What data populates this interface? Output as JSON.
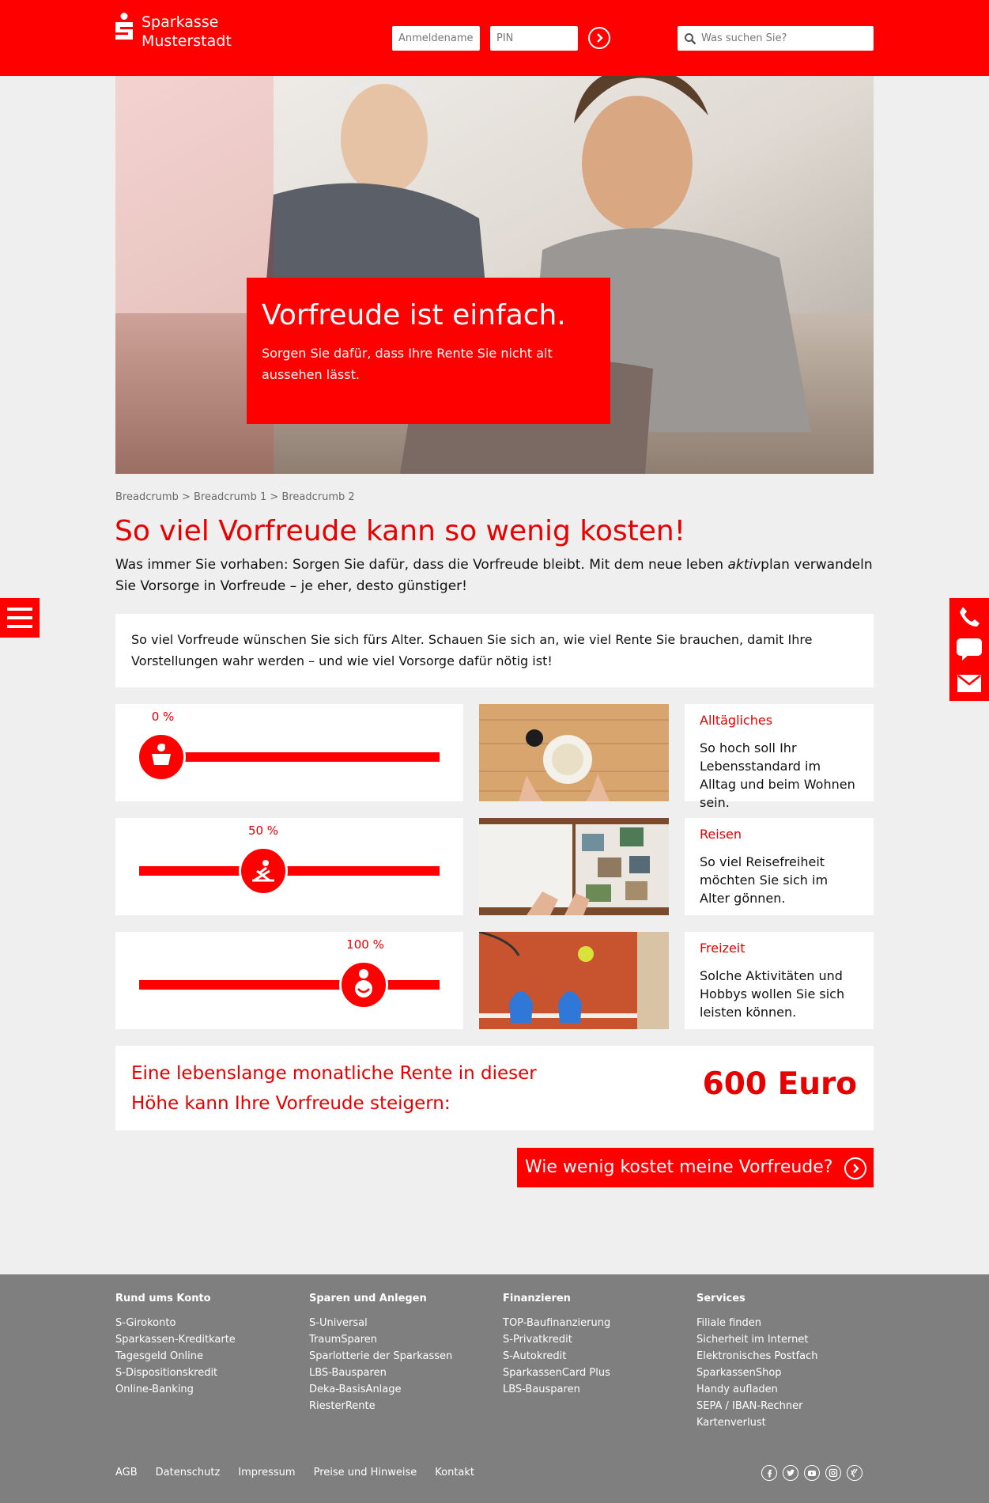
{
  "brand": {
    "line1": "Sparkasse",
    "line2": "Musterstadt",
    "color": "#ff0000"
  },
  "login": {
    "username_placeholder": "Anmeldename",
    "pin_placeholder": "PIN"
  },
  "search": {
    "placeholder": "Was suchen Sie?"
  },
  "hero": {
    "title": "Vorfreude ist einfach.",
    "subtitle": "Sorgen Sie dafür, dass Ihre Rente Sie nicht alt aussehen lässt."
  },
  "breadcrumb": "Breadcrumb > Breadcrumb 1 > Breadcrumb 2",
  "page_title": "So viel Vorfreude kann so wenig kosten!",
  "intro": {
    "part1": "Was immer Sie vorhaben: Sorgen Sie dafür, dass die Vorfreude bleibt. Mit dem neue leben ",
    "italic": "aktiv",
    "part2": "plan verwandeln Sie Vorsorge in Vorfreude – je eher, desto günstiger!"
  },
  "info_text": "So viel Vorfreude wünschen Sie sich fürs Alter. Schauen Sie sich an, wie viel Rente Sie brauchen, damit Ihre Vorstellungen wahr werden – und wie viel Vorsorge dafür nötig ist!",
  "rows": [
    {
      "percent_label": "0 %",
      "percent": 0,
      "icon": "mortar-pestle-icon",
      "title": "Alltägliches",
      "desc": "So hoch soll Ihr Lebensstandard im Alltag und beim Wohnen sein.",
      "image": "breakfast-table-image"
    },
    {
      "percent_label": "50 %",
      "percent": 50,
      "icon": "beach-chair-icon",
      "title": "Reisen",
      "desc": "So viel Reisefreiheit möchten Sie sich im Alter gönnen.",
      "image": "photo-album-image"
    },
    {
      "percent_label": "100 %",
      "percent": 100,
      "icon": "person-icon",
      "title": "Freizeit",
      "desc": "Solche Aktivitäten und Hobbys wollen Sie sich leisten können.",
      "image": "tennis-court-image"
    }
  ],
  "result": {
    "line1": "Eine lebenslange monatliche Rente in dieser",
    "line2": "Höhe kann Ihre Vorfreude steigern:",
    "value": "600 Euro"
  },
  "cta": {
    "label": "Wie wenig kostet meine Vorfreude?"
  },
  "footer": {
    "columns": [
      {
        "title": "Rund ums Konto",
        "links": [
          "S-Girokonto",
          "Sparkassen-Kreditkarte",
          "Tagesgeld Online",
          "S-Dispositionskredit",
          "Online-Banking"
        ]
      },
      {
        "title": "Sparen und Anlegen",
        "links": [
          "S-Universal",
          "TraumSparen",
          "Sparlotterie der Sparkassen",
          "LBS-Bausparen",
          "Deka-BasisAnlage",
          "RiesterRente"
        ]
      },
      {
        "title": "Finanzieren",
        "links": [
          "TOP-Baufinanzierung",
          "S-Privatkredit",
          "S-Autokredit",
          "SparkassenCard Plus",
          "LBS-Bausparen"
        ]
      },
      {
        "title": "Services",
        "links": [
          "Filiale finden",
          "Sicherheit im Internet",
          "Elektronisches Postfach",
          "SparkassenShop",
          "Handy aufladen",
          "SEPA / IBAN-Rechner",
          "Kartenverlust"
        ]
      }
    ],
    "bottom_links": [
      "AGB",
      "Datenschutz",
      "Impressum",
      "Preise und Hinweise",
      "Kontakt"
    ],
    "social": [
      "facebook-icon",
      "twitter-icon",
      "youtube-icon",
      "instagram-icon",
      "xing-icon"
    ]
  }
}
